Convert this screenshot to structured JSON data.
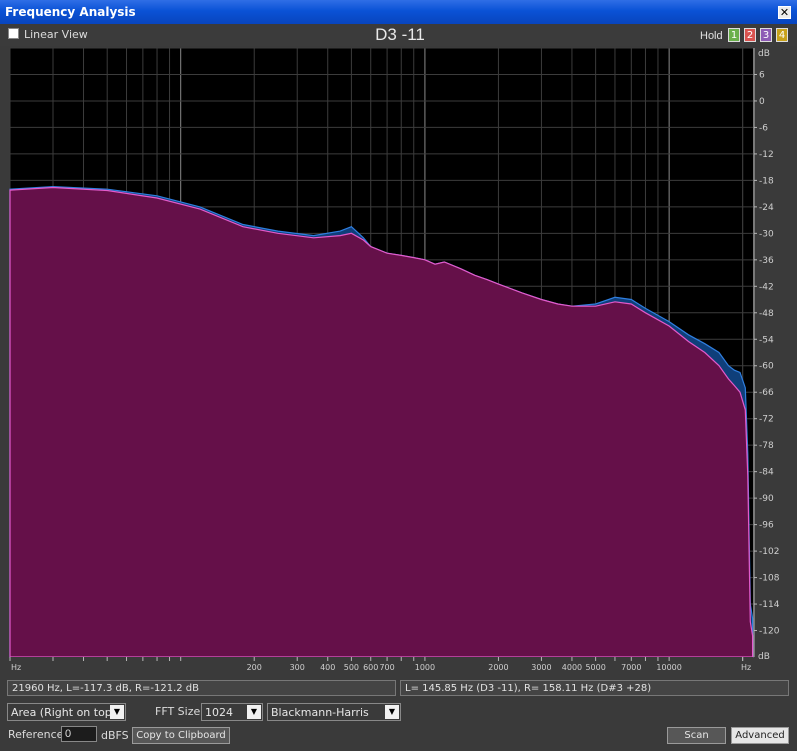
{
  "window": {
    "title": "Frequency Analysis",
    "close_glyph": "✕"
  },
  "toolbar": {
    "linear_view_label": "Linear View",
    "linear_view_checked": false,
    "note_readout": "D3 -11",
    "hold_label": "Hold",
    "hold_buttons": [
      {
        "label": "1",
        "color": "#6ab04c"
      },
      {
        "label": "2",
        "color": "#d9534f"
      },
      {
        "label": "3",
        "color": "#8e5bb5"
      },
      {
        "label": "4",
        "color": "#c8a21c"
      }
    ]
  },
  "chart_data": {
    "type": "area",
    "x_scale": "log",
    "xlim": [
      20,
      22050
    ],
    "ylim": [
      -126,
      12
    ],
    "x_unit_label": "Hz",
    "y_unit_label": "dB",
    "x_tick_labels": [
      {
        "value": 200,
        "label": "200"
      },
      {
        "value": 300,
        "label": "300"
      },
      {
        "value": 400,
        "label": "400"
      },
      {
        "value": 500,
        "label": "500"
      },
      {
        "value": 600,
        "label": "600"
      },
      {
        "value": 700,
        "label": "700"
      },
      {
        "value": 1000,
        "label": "1000"
      },
      {
        "value": 2000,
        "label": "2000"
      },
      {
        "value": 3000,
        "label": "3000"
      },
      {
        "value": 4000,
        "label": "4000"
      },
      {
        "value": 5000,
        "label": "5000"
      },
      {
        "value": 7000,
        "label": "7000"
      },
      {
        "value": 10000,
        "label": "10000"
      }
    ],
    "y_ticks": [
      6,
      0,
      -6,
      -12,
      -18,
      -24,
      -30,
      -36,
      -42,
      -48,
      -54,
      -60,
      -66,
      -72,
      -78,
      -84,
      -90,
      -96,
      -102,
      -108,
      -114,
      -120
    ],
    "grid": true,
    "series": [
      {
        "channel": "right",
        "stroke": "#2f7fe0",
        "fill": "#0f3f7a",
        "x": [
          20,
          30,
          50,
          80,
          120,
          180,
          250,
          350,
          450,
          500,
          560,
          600,
          700,
          800,
          900,
          1000,
          1100,
          1200,
          1400,
          1600,
          1800,
          2000,
          2500,
          3000,
          3500,
          4000,
          5000,
          6000,
          7000,
          8000,
          10000,
          12000,
          14000,
          16000,
          17500,
          18500,
          19500,
          20500,
          21000,
          21500,
          21960
        ],
        "y": [
          -20,
          -19.4,
          -20,
          -21.5,
          -24,
          -28,
          -29.5,
          -30.5,
          -29.5,
          -28.5,
          -31,
          -33,
          -34.5,
          -35,
          -35.5,
          -36,
          -37,
          -36.5,
          -38,
          -39.5,
          -40.5,
          -41.5,
          -43.5,
          -45,
          -46,
          -46.5,
          -46,
          -44.5,
          -45,
          -47,
          -50,
          -53,
          -55,
          -57,
          -60,
          -61,
          -61.5,
          -65,
          -80,
          -114,
          -117.3
        ]
      },
      {
        "channel": "left",
        "stroke": "#e35bcb",
        "fill": "#651049",
        "x": [
          20,
          30,
          50,
          80,
          120,
          180,
          250,
          350,
          450,
          500,
          560,
          600,
          700,
          800,
          900,
          1000,
          1100,
          1200,
          1400,
          1600,
          1800,
          2000,
          2500,
          3000,
          3500,
          4000,
          5000,
          6000,
          7000,
          8000,
          10000,
          12000,
          14000,
          16000,
          17500,
          18500,
          19500,
          20500,
          21000,
          21500,
          21960
        ],
        "y": [
          -20.2,
          -19.6,
          -20.3,
          -22,
          -24.5,
          -28.5,
          -30,
          -31,
          -30.5,
          -30,
          -31.5,
          -33,
          -34.5,
          -35,
          -35.5,
          -36,
          -37,
          -36.5,
          -38,
          -39.5,
          -40.5,
          -41.5,
          -43.5,
          -45,
          -46,
          -46.5,
          -46.5,
          -45.5,
          -46,
          -48,
          -51,
          -54.5,
          -57,
          -60,
          -63,
          -64.5,
          -66,
          -70,
          -85,
          -118,
          -121.2
        ]
      }
    ]
  },
  "status": {
    "cursor_readout": "21960 Hz, L=-117.3 dB, R=-121.2 dB",
    "peak_readout": "L= 145.85 Hz (D3 -11), R= 158.11 Hz (D#3 +28)"
  },
  "controls": {
    "display_mode": "Area (Right on top)",
    "fft_size_label": "FFT Size",
    "fft_size_value": "1024",
    "window_function": "Blackmann-Harris",
    "reference_label": "Reference",
    "reference_value": "0",
    "reference_unit": "dBFS",
    "copy_button": "Copy to Clipboard",
    "scan_button": "Scan",
    "advanced_button": "Advanced"
  }
}
